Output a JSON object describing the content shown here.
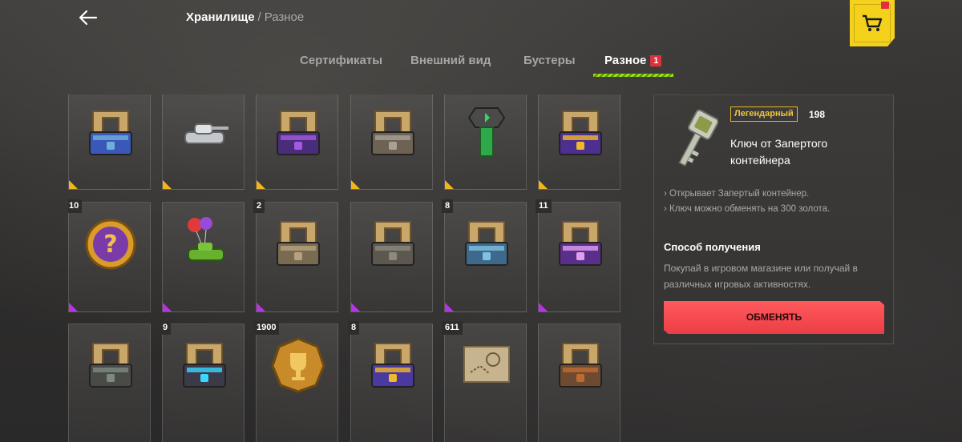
{
  "header": {
    "breadcrumb_main": "Хранилище",
    "breadcrumb_separator": "/",
    "breadcrumb_current": "Разное",
    "back_icon": "arrow-left-icon",
    "shop_icon": "cart-icon"
  },
  "tabs": [
    {
      "label": "Сертификаты",
      "active": false
    },
    {
      "label": "Внешний вид",
      "active": false
    },
    {
      "label": "Бустеры",
      "active": false
    },
    {
      "label": "Разное",
      "active": true,
      "badge": "1"
    }
  ],
  "colors": {
    "accent_green": "#9be015",
    "legendary": "#f0c53a",
    "epic": "#b832e6",
    "rare": "#1ea6e8",
    "button_red": "#f24a50",
    "shop_yellow": "#f4d21c"
  },
  "items": [
    {
      "name": "container-blue",
      "count": "",
      "rarity": "legendary"
    },
    {
      "name": "tank-white",
      "count": "",
      "rarity": "legendary"
    },
    {
      "name": "container-purple-skull",
      "count": "",
      "rarity": "legendary"
    },
    {
      "name": "container-wings",
      "count": "",
      "rarity": "legendary"
    },
    {
      "name": "bolt-green",
      "count": "",
      "rarity": "legendary"
    },
    {
      "name": "container-question",
      "count": "",
      "rarity": "legendary"
    },
    {
      "name": "question-coin",
      "count": "10",
      "rarity": "epic"
    },
    {
      "name": "tank-balloons",
      "count": "",
      "rarity": "epic"
    },
    {
      "name": "container-bronze",
      "count": "2",
      "rarity": "epic"
    },
    {
      "name": "container-44",
      "count": "",
      "rarity": "epic"
    },
    {
      "name": "container-blue-steel",
      "count": "8",
      "rarity": "epic"
    },
    {
      "name": "container-purple-art",
      "count": "11",
      "rarity": "epic"
    },
    {
      "name": "container-gears",
      "count": "",
      "rarity": "epic"
    },
    {
      "name": "container-digital",
      "count": "9",
      "rarity": "epic"
    },
    {
      "name": "trophy-coin",
      "count": "1900",
      "rarity": "epic"
    },
    {
      "name": "container-purple-lock",
      "count": "8",
      "rarity": "rare"
    },
    {
      "name": "map-piece",
      "count": "611",
      "rarity": "rare"
    },
    {
      "name": "container-rust",
      "count": "",
      "rarity": "rare"
    }
  ],
  "detail": {
    "rarity_label": "Легендарный",
    "count": "198",
    "item_name": "Ключ от Запертого контейнера",
    "description": [
      "Открывает Запертый контейнер.",
      "Ключ можно обменять на 300 золота."
    ],
    "obtain_title": "Способ получения",
    "obtain_text": "Покупай в игровом магазине или получай в различных игровых активностях.",
    "exchange_label": "ОБМЕНЯТЬ",
    "icon": "key-icon"
  }
}
